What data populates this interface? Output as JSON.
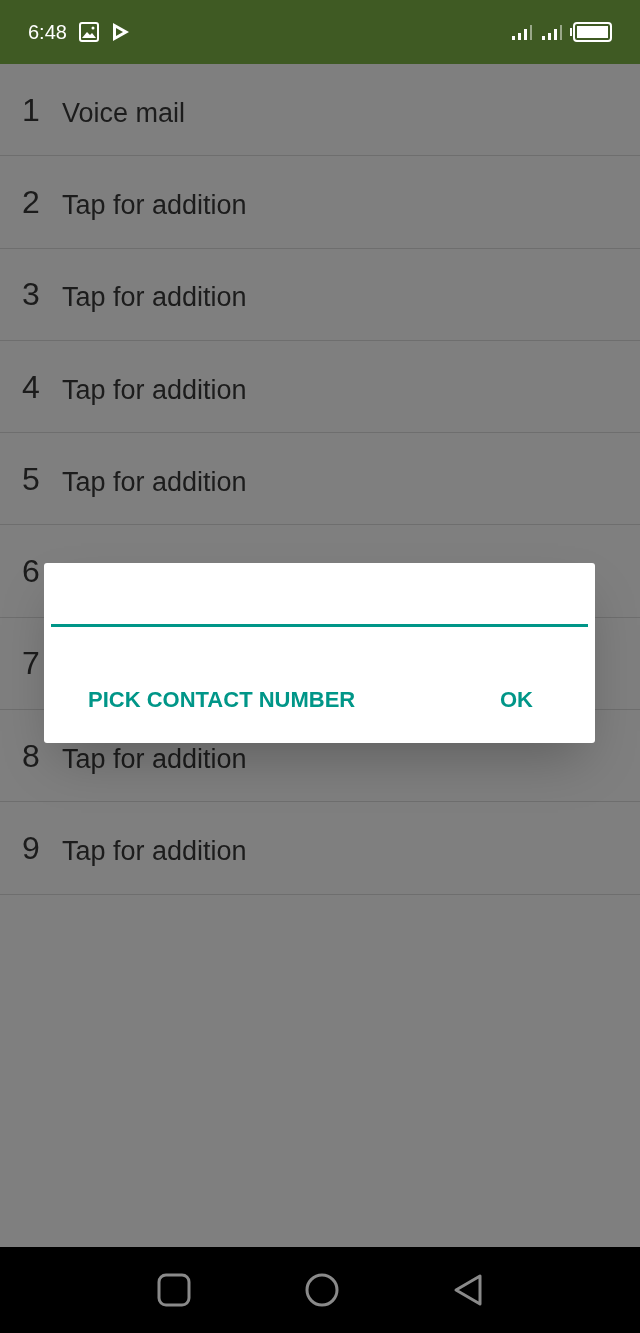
{
  "status_bar": {
    "time": "6:48"
  },
  "list": {
    "rows": [
      {
        "number": "1",
        "label": "Voice mail"
      },
      {
        "number": "2",
        "label": "Tap for addition"
      },
      {
        "number": "3",
        "label": "Tap for addition"
      },
      {
        "number": "4",
        "label": "Tap for addition"
      },
      {
        "number": "5",
        "label": "Tap for addition"
      },
      {
        "number": "6"
      },
      {
        "number": "7"
      },
      {
        "number": "8",
        "label": "Tap for addition"
      },
      {
        "number": "9",
        "label": "Tap for addition"
      }
    ]
  },
  "dialog": {
    "buttons": [
      {
        "label": "PICK CONTACT NUMBER"
      },
      {
        "label": "OK"
      }
    ]
  }
}
